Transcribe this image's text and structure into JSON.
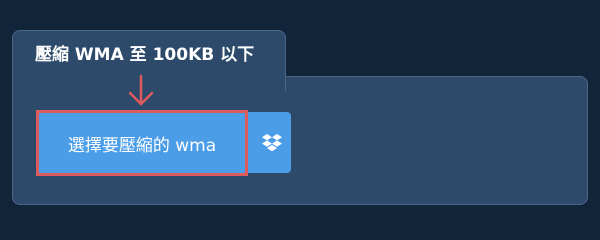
{
  "section": {
    "title": "壓縮 WMA 至 100KB 以下"
  },
  "upload": {
    "select_label": "選擇要壓縮的 wma",
    "dropbox_icon": "dropbox-icon",
    "arrow_icon": "arrow-down-icon"
  },
  "colors": {
    "background": "#12243a",
    "panel": "#2d4a6b",
    "panel_border": "#4b6689",
    "button": "#4b9de8",
    "highlight": "#dd5a5e"
  }
}
